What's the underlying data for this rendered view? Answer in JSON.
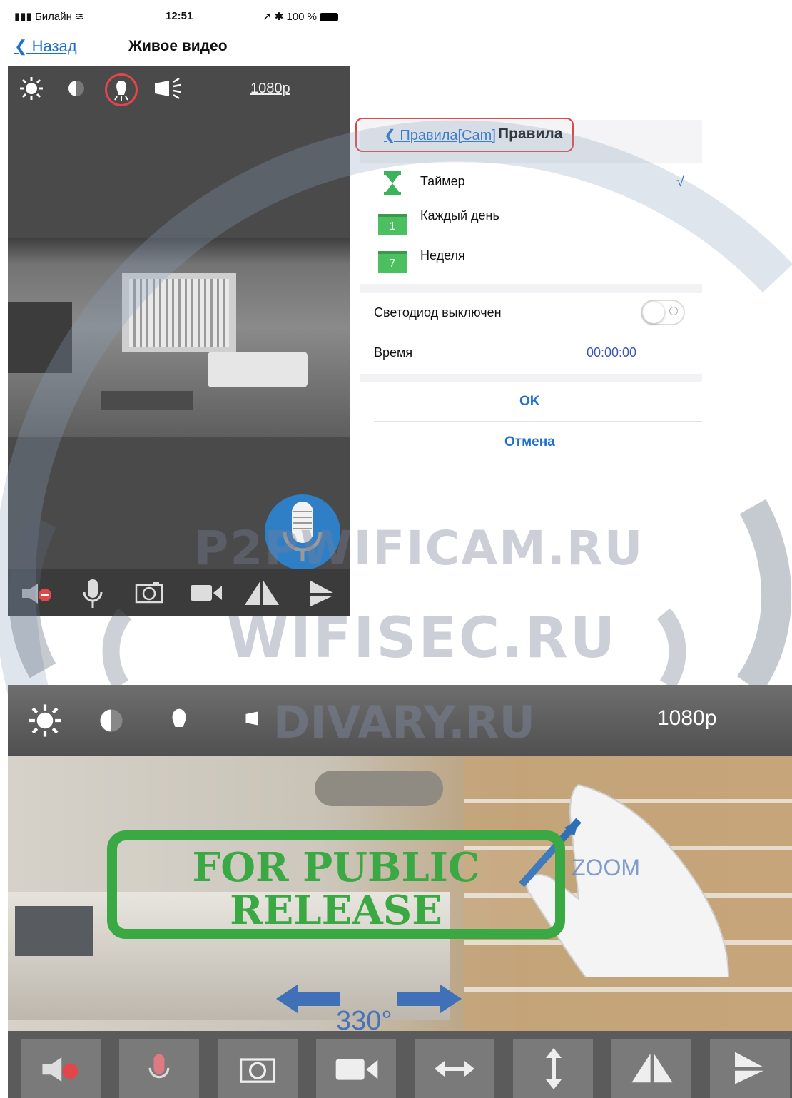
{
  "status_bar": {
    "carrier": "Билайн",
    "time": "12:51",
    "battery": "100 %"
  },
  "nav": {
    "back_label": "Назад",
    "title": "Живое видео"
  },
  "phone_video": {
    "resolution": "1080p",
    "toolbar_icons": [
      "brightness-icon",
      "contrast-icon",
      "bulb-icon",
      "ir-light-icon"
    ],
    "bottom_icons": [
      "speaker-muted-icon",
      "microphone-icon",
      "camera-icon",
      "video-icon",
      "flip-horizontal-icon",
      "flip-vertical-icon"
    ]
  },
  "rules": {
    "back_label": "Правила[Cam]",
    "title": "Правила",
    "items": [
      {
        "label": "Таймер",
        "check": "√"
      },
      {
        "label": "Каждый день",
        "badge": "1"
      },
      {
        "label": "Неделя",
        "badge": "7"
      }
    ],
    "led_label": "Светодиод выключен",
    "led_on": false,
    "time_label": "Время",
    "time_value": "00:00:00",
    "ok_label": "OK",
    "cancel_label": "Отмена"
  },
  "watermarks": {
    "p2p": "P2PWIFICAM.RU",
    "wifisec": "WIFISEC.RU",
    "divary": "DIVARY.RU"
  },
  "large_video": {
    "resolution": "1080p",
    "zoom_label": "ZOOM",
    "pan_label": "330°",
    "toolbar_icons": [
      "brightness-icon",
      "contrast-icon",
      "bulb-icon",
      "ir-light-icon"
    ],
    "bottom_icons": [
      "speaker-muted-icon",
      "microphone-icon",
      "camera-icon",
      "video-icon",
      "pan-horizontal-icon",
      "pan-vertical-icon",
      "flip-horizontal-icon",
      "flip-vertical-icon"
    ]
  },
  "stamp": {
    "line1": "FOR PUBLIC",
    "line2": "RELEASE"
  },
  "colors": {
    "accent": "#1f6fd1",
    "highlight": "#e0464a",
    "stamp": "#3aa843",
    "badge": "#4cbf60"
  }
}
